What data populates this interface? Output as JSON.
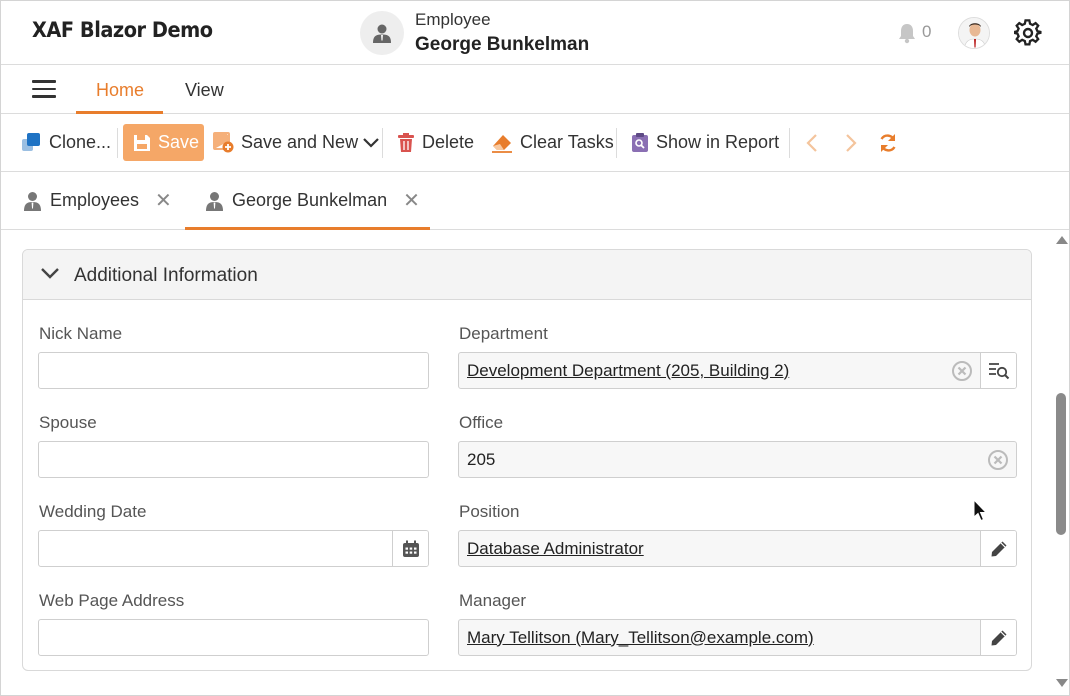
{
  "app": {
    "title": "XAF Blazor Demo"
  },
  "header": {
    "caption": "Employee",
    "name": "George Bunkelman",
    "notification_count": "0",
    "icons": {
      "avatar": "person-icon",
      "bell": "bell-icon",
      "user": "user-photo",
      "settings": "gear-icon"
    }
  },
  "ribbon": {
    "menu_icon": "hamburger-icon",
    "tabs": [
      {
        "label": "Home",
        "active": true
      },
      {
        "label": "View",
        "active": false
      }
    ]
  },
  "toolbar": {
    "clone_label": "Clone...",
    "save_label": "Save",
    "save_new_label": "Save and New",
    "delete_label": "Delete",
    "clear_tasks_label": "Clear Tasks",
    "show_report_label": "Show in Report"
  },
  "doc_tabs": [
    {
      "label": "Employees",
      "active": false
    },
    {
      "label": "George Bunkelman",
      "active": true
    }
  ],
  "group": {
    "title": "Additional Information",
    "left_fields": [
      {
        "label": "Nick Name",
        "value": ""
      },
      {
        "label": "Spouse",
        "value": ""
      },
      {
        "label": "Wedding Date",
        "value": ""
      },
      {
        "label": "Web Page Address",
        "value": ""
      }
    ],
    "right_fields": [
      {
        "label": "Department",
        "value": "Development Department (205, Building 2)"
      },
      {
        "label": "Office",
        "value": "205"
      },
      {
        "label": "Position",
        "value": "Database Administrator"
      },
      {
        "label": "Manager",
        "value": "Mary Tellitson (Mary_Tellitson@example.com)"
      }
    ]
  },
  "colors": {
    "accent": "#e87d2c",
    "save_button": "#f5a767",
    "delete_icon": "#d9534f",
    "clone_icon": "#1f73c4"
  }
}
